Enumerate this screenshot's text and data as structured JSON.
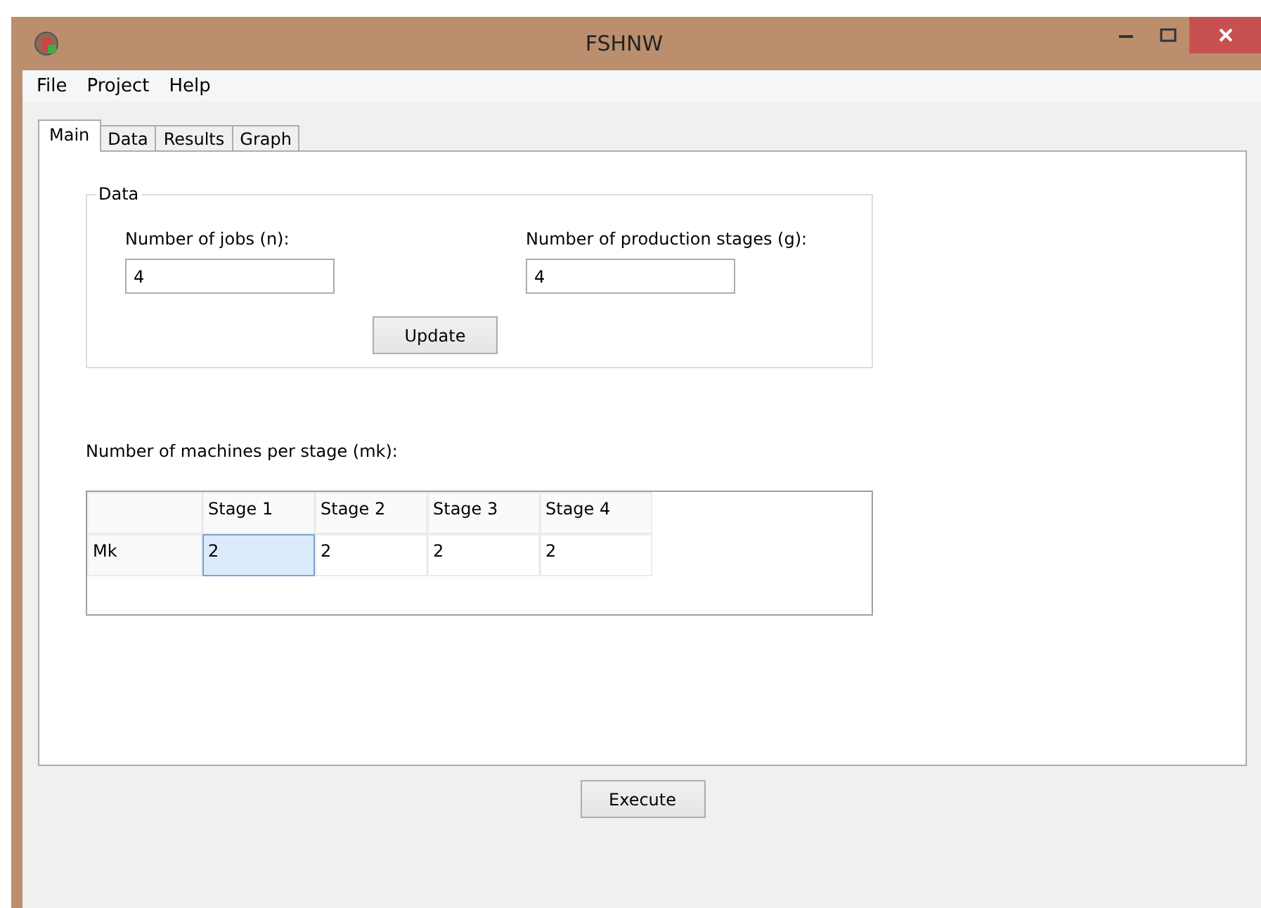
{
  "window": {
    "title": "FSHNW"
  },
  "menu": [
    "File",
    "Project",
    "Help"
  ],
  "tabs": [
    {
      "label": "Main",
      "selected": true
    },
    {
      "label": "Data",
      "selected": false
    },
    {
      "label": "Results",
      "selected": false
    },
    {
      "label": "Graph",
      "selected": false
    }
  ],
  "data_group": {
    "title": "Data",
    "jobs": {
      "label": "Number of jobs (n):",
      "value": "4"
    },
    "stages": {
      "label": "Number of production stages (g):",
      "value": "4"
    },
    "update_button": "Update"
  },
  "machines": {
    "label": "Number of machines per stage (mk):",
    "columns": [
      "Stage 1",
      "Stage 2",
      "Stage 3",
      "Stage 4"
    ],
    "rows": [
      {
        "header": "Mk",
        "cells": [
          {
            "value": "2",
            "selected": true
          },
          {
            "value": "2",
            "selected": false
          },
          {
            "value": "2",
            "selected": false
          },
          {
            "value": "2",
            "selected": false
          }
        ]
      }
    ]
  },
  "execute_button": "Execute"
}
